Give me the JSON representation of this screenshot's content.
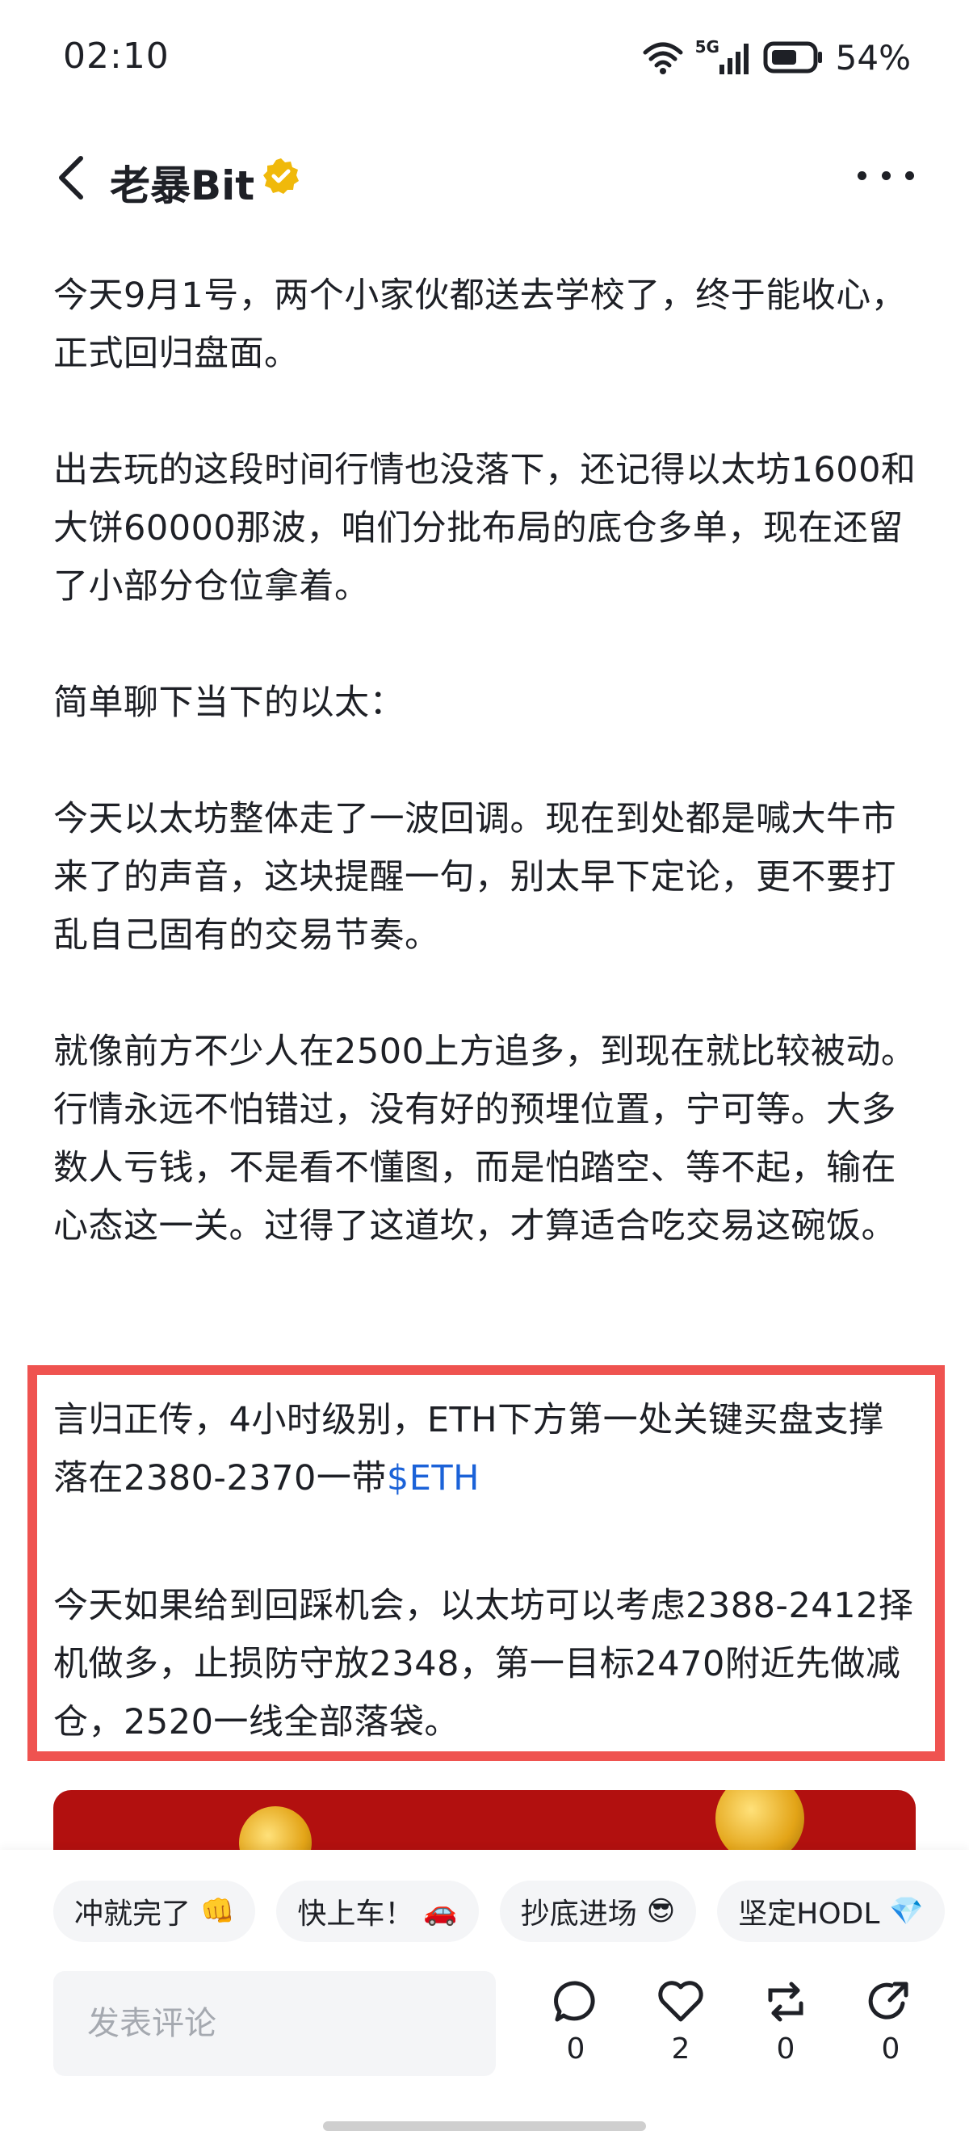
{
  "status_bar": {
    "time": "02:10",
    "network": "5G",
    "battery": "54%"
  },
  "header": {
    "title": "老暴Bit",
    "verified_icon": "verified-badge-icon",
    "back_icon": "chevron-left-icon",
    "more_icon": "more-dots-icon"
  },
  "article": {
    "paragraphs": [
      "今天9月1号，两个小家伙都送去学校了，终于能收心，正式回归盘面。",
      "出去玩的这段时间行情也没落下，还记得以太坊1600和大饼60000那波，咱们分批布局的底仓多单，现在还留了小部分仓位拿着。",
      "简单聊下当下的以太：",
      "今天以太坊整体走了一波回调。现在到处都是喊大牛市来了的声音，这块提醒一句，别太早下定论，更不要打乱自己固有的交易节奏。",
      "就像前方不少人在2500上方追多，到现在就比较被动。行情永远不怕错过，没有好的预埋位置，宁可等。大多数人亏钱，不是看不懂图，而是怕踏空、等不起，输在心态这一关。过得了这道坎，才算适合吃交易这碗饭。"
    ],
    "highlight": {
      "line1": "言归正传，4小时级别，ETH下方第一处关键买盘支撑落在2380-2370一带",
      "ticker": "$ETH",
      "line2": "今天如果给到回踩机会，以太坊可以考虑2388-2412择机做多，止损防守放2348，第一目标2470附近先做减仓，2520一线全部落袋。",
      "border_color": "#ef5350",
      "link_color": "#1b62d8"
    }
  },
  "reactions": [
    {
      "label": "冲就完了",
      "emoji": "👊"
    },
    {
      "label": "快上车！",
      "emoji": "🚗"
    },
    {
      "label": "抄底进场",
      "emoji": "😎"
    },
    {
      "label": "坚定HODL",
      "emoji": "💎"
    }
  ],
  "comment": {
    "placeholder": "发表评论"
  },
  "actions": {
    "comment_count": "0",
    "like_count": "2",
    "repost_count": "0",
    "share_count": "0"
  }
}
